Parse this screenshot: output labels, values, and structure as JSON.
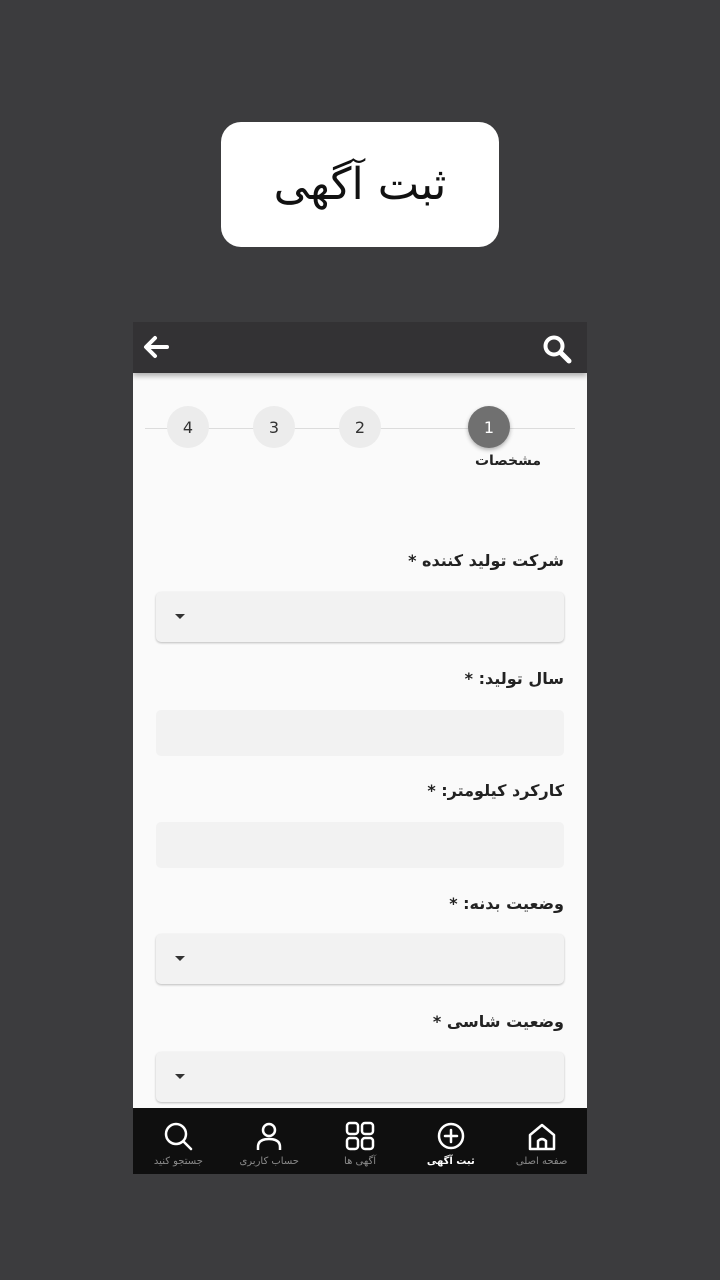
{
  "banner": {
    "title": "ثبت آگهی"
  },
  "stepper": {
    "steps": [
      "1",
      "2",
      "3",
      "4"
    ],
    "active_label": "مشخصات"
  },
  "form": {
    "manufacturer_label": "شرکت تولید کننده *",
    "year_label": "سال تولید: *",
    "mileage_label": "کارکرد کیلومتر: *",
    "body_label": "وضعیت بدنه: *",
    "chassis_label": "وضعیت شاسی *"
  },
  "nav": {
    "home": "صفحه اصلی",
    "post_ad": "ثبت آگهی",
    "ads": "آگهی ها",
    "account": "حساب کاربری",
    "search": "جستجو کنید"
  },
  "colors": {
    "background": "#3c3c3e",
    "topbar": "#333234",
    "active_step": "#707070",
    "bottom_nav": "#0f0f0f"
  }
}
